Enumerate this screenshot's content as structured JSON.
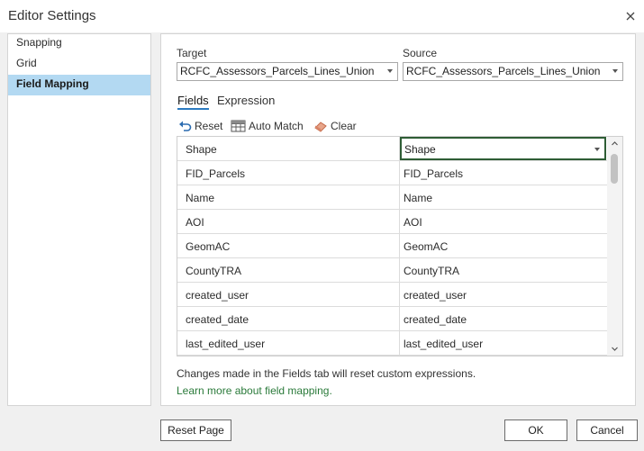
{
  "window": {
    "title": "Editor Settings"
  },
  "sidebar": {
    "items": [
      {
        "label": "Snapping"
      },
      {
        "label": "Grid"
      },
      {
        "label": "Field Mapping"
      }
    ]
  },
  "target": {
    "label": "Target",
    "value": "RCFC_Assessors_Parcels_Lines_Union"
  },
  "source": {
    "label": "Source",
    "value": "RCFC_Assessors_Parcels_Lines_Union"
  },
  "tabs": [
    {
      "label": "Fields"
    },
    {
      "label": "Expression"
    }
  ],
  "toolbar": {
    "reset_label": "Reset",
    "auto_match_label": "Auto Match",
    "clear_label": "Clear"
  },
  "fields_table": {
    "rows": [
      {
        "target": "Shape",
        "source": "Shape"
      },
      {
        "target": "FID_Parcels",
        "source": "FID_Parcels"
      },
      {
        "target": "Name",
        "source": "Name"
      },
      {
        "target": "AOI",
        "source": "AOI"
      },
      {
        "target": "GeomAC",
        "source": "GeomAC"
      },
      {
        "target": "CountyTRA",
        "source": "CountyTRA"
      },
      {
        "target": "created_user",
        "source": "created_user"
      },
      {
        "target": "created_date",
        "source": "created_date"
      },
      {
        "target": "last_edited_user",
        "source": "last_edited_user"
      }
    ]
  },
  "info": {
    "note": "Changes made in the Fields tab will reset custom expressions.",
    "link": "Learn more about field mapping."
  },
  "footer": {
    "reset_page_label": "Reset Page",
    "ok_label": "OK",
    "cancel_label": "Cancel"
  },
  "colors": {
    "accent": "#2b7ac0",
    "selected_sidebar": "#b3d9f2",
    "link": "#2a7a3a",
    "focus_border": "#2e5d35"
  }
}
